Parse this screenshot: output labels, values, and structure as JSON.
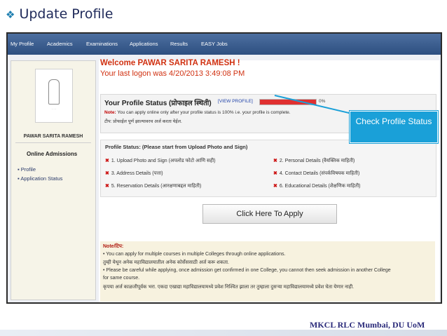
{
  "slide": {
    "bullet_icon": "diamond-bullet-icon",
    "title": "Update Profile",
    "footer": "MKCL RLC Mumbai, DU UoM"
  },
  "nav": {
    "items": [
      "My Profile",
      "Academics",
      "Examinations",
      "Applications",
      "Results",
      "EASY Jobs"
    ]
  },
  "sidebar": {
    "name": "PAWAR SARITA RAMESH",
    "section": "Online Admissions",
    "links": [
      "Profile",
      "Application Status"
    ]
  },
  "main": {
    "welcome": "Welcome PAWAR SARITA RAMESH !",
    "last_logon": "Your last logon was 4/20/2013 3:49:08 PM",
    "profile_status_title": "Your Profile Status (प्रोफाइल स्थिती)",
    "view_profile": "[VIEW PROFILE]",
    "progress": {
      "percent_label": "0%",
      "bar_color": "#e03030"
    },
    "note_label": "Note:",
    "note_text": "You can apply online only after your profile status is 100% i.e. your profile is complete.",
    "note_marathi": "टीप: प्रोफाईल पूर्ण झाल्यावरच अर्ज करता येईल.",
    "steps_title": "Profile Status: (Please start from Upload Photo and Sign)",
    "steps": [
      "1. Upload Photo and Sign (अपलोड फोटो आणि सही)",
      "2. Personal Details (वैयक्तिक माहिती)",
      "3. Address Details (पत्ता)",
      "4. Contact Details (संपर्कविषयक माहिती)",
      "5. Reservation Details (आरक्षणाबद्दल माहिती)",
      "6. Educational Details (शैक्षणिक माहिती)"
    ],
    "apply_button": "Click Here To Apply"
  },
  "notes": {
    "header": "Note/टिप:",
    "lines": [
      "• You can apply for multiple courses in multiple Colleges through online applications.",
      "तुम्ही येथून अनेक महाविद्यालयातील अनेक कोर्सेससाठी अर्ज करू शकता.",
      "• Please be careful while applying, once admission get confirmed in one College, you cannot then seek admission in another College",
      "for same course.",
      "कृपया अर्ज काळजीपूर्वक भरा. एकदा एखाद्या महाविद्यालयामध्ये प्रवेश निश्चित झाला तर तुम्हाला दुसऱ्या महाविद्यालयामध्ये प्रवेश घेता येणार नाही."
    ]
  },
  "callout": {
    "text": "Check Profile Status",
    "color": "#1aa0d8"
  }
}
